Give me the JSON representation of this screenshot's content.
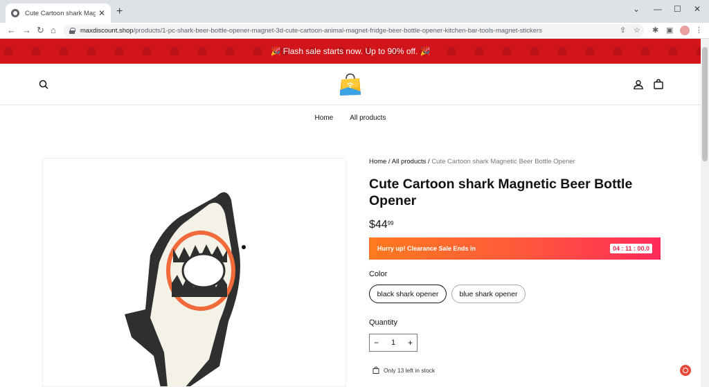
{
  "browser": {
    "tab_title": "Cute Cartoon shark Magnetic Be...",
    "close_glyph": "✕",
    "new_tab_glyph": "+",
    "url_domain": "maxdiscount.shop",
    "url_path": "/products/1-pc-shark-beer-bottle-opener-magnet-3d-cute-cartoon-animal-magnet-fridge-beer-bottle-opener-kitchen-bar-tools-magnet-stickers"
  },
  "announcement": {
    "text": "🎉 Flash sale starts now. Up to 90% off. 🎉",
    "color": "#d1151b"
  },
  "header": {
    "icons": [
      "search-icon",
      "store-logo",
      "account-icon",
      "cart-icon"
    ]
  },
  "menu": {
    "items": [
      {
        "label": "Home"
      },
      {
        "label": "All products"
      }
    ]
  },
  "product": {
    "breadcrumb": {
      "home": "Home",
      "sep": " / ",
      "collection": "All products",
      "current": "Cute Cartoon shark Magnetic Beer Bottle Opener"
    },
    "title": "Cute Cartoon shark Magnetic Beer Bottle Opener",
    "price_main": "$44",
    "price_cents": "99",
    "sale": {
      "text": "Hurry up! Clearance Sale Ends in",
      "countdown": "04 : 11 : 00.0"
    },
    "color_label": "Color",
    "variants": [
      {
        "label": "black shark opener",
        "selected": true
      },
      {
        "label": "blue shark opener",
        "selected": false
      }
    ],
    "quantity_label": "Quantity",
    "quantity": "1",
    "minus": "−",
    "plus": "+",
    "stock_text": "Only 13 left in stock"
  }
}
